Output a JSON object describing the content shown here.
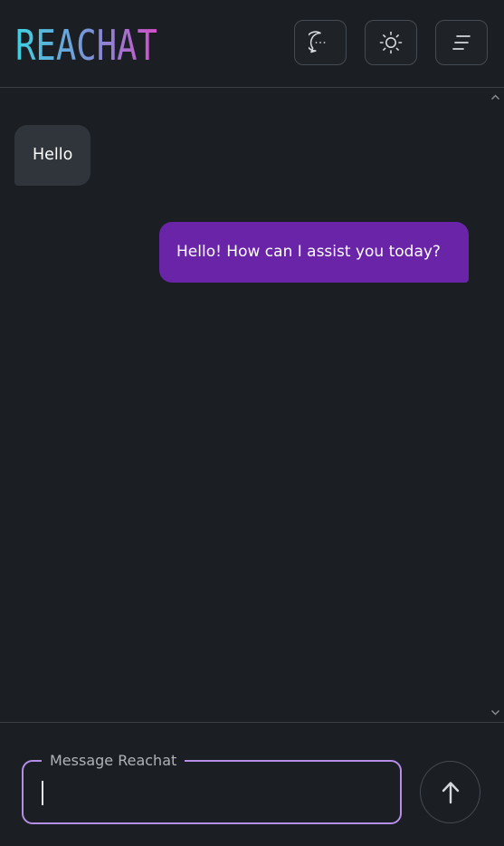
{
  "header": {
    "logo_text": "REACHAT",
    "buttons": [
      {
        "name": "new-chat",
        "icon": "chat-bubble-icon"
      },
      {
        "name": "theme-toggle",
        "icon": "sun-icon"
      },
      {
        "name": "menu",
        "icon": "hamburger-icon"
      }
    ]
  },
  "messages": [
    {
      "role": "user",
      "text": "Hello"
    },
    {
      "role": "assistant",
      "text": "Hello! How can I assist you today?"
    }
  ],
  "composer": {
    "label": "Message Reachat",
    "value": ""
  },
  "colors": {
    "background": "#1b1f23",
    "user_bubble": "#2f353b",
    "assistant_bubble": "#6a24a8",
    "input_border": "#b58ee8",
    "logo_gradient": [
      "#3ed1e0",
      "#d44fc8"
    ]
  }
}
